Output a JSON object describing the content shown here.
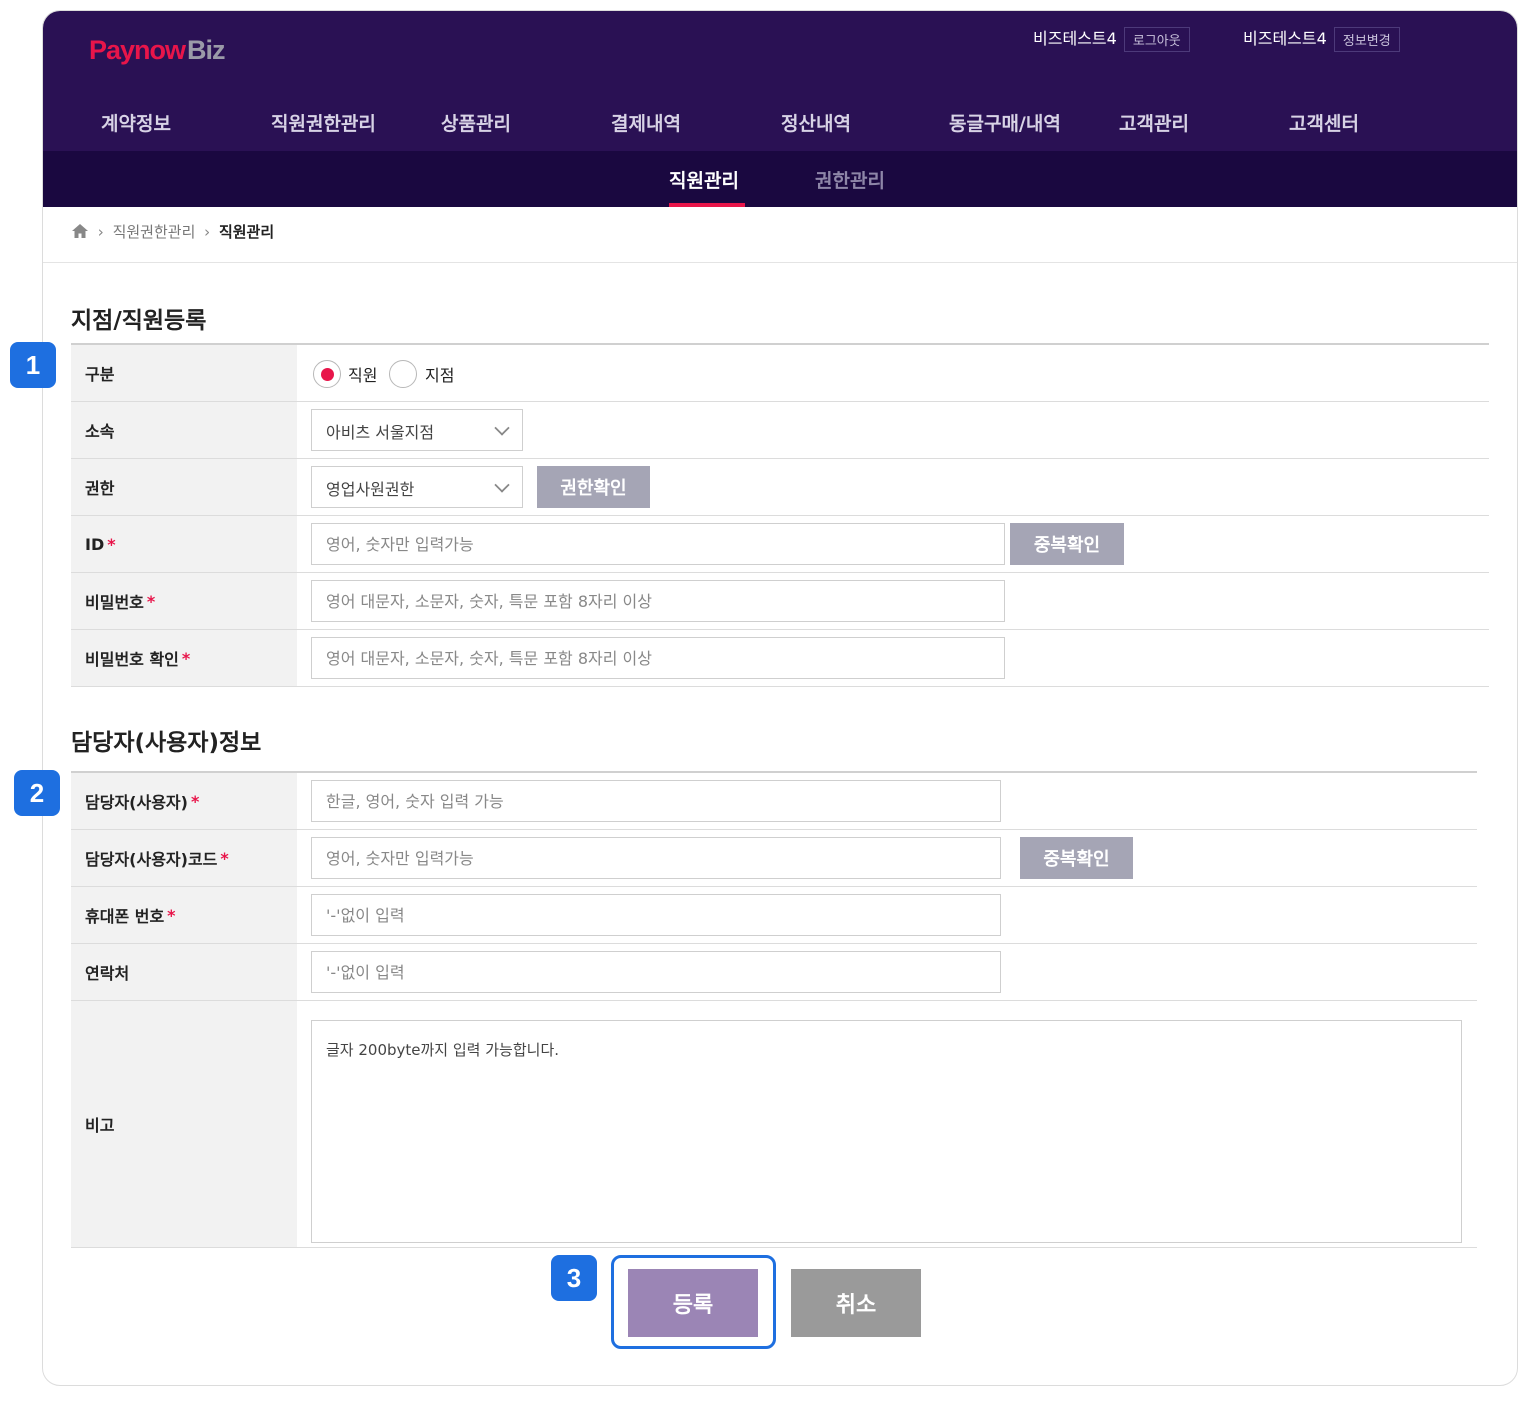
{
  "header": {
    "logo_part1": "Paynow",
    "logo_part2": "Biz",
    "user1_name": "비즈테스트4",
    "user1_btn": "로그아웃",
    "user2_name": "비즈테스트4",
    "user2_btn": "정보변경"
  },
  "nav": {
    "items": [
      "계약정보",
      "직원권한관리",
      "상품관리",
      "결제내역",
      "정산내역",
      "동글구매/내역",
      "고객관리",
      "고객센터"
    ],
    "sub_items": [
      "직원관리",
      "권한관리"
    ]
  },
  "breadcrumb": {
    "parent": "직원권한관리",
    "current": "직원관리"
  },
  "section1": {
    "title": "지점/직원등록",
    "type_label": "구분",
    "radio_staff": "직원",
    "radio_branch": "지점",
    "affiliation_label": "소속",
    "affiliation_value": "아비츠 서울지점",
    "permission_label": "권한",
    "permission_value": "영업사원권한",
    "permission_check_btn": "권한확인",
    "id_label": "ID",
    "id_placeholder": "영어, 숫자만 입력가능",
    "id_dup_btn": "중복확인",
    "pw_label": "비밀번호",
    "pw_placeholder": "영어 대문자, 소문자, 숫자, 특문 포함 8자리 이상",
    "pw_confirm_label": "비밀번호 확인",
    "pw_confirm_placeholder": "영어 대문자, 소문자, 숫자, 특문 포함 8자리 이상"
  },
  "section2": {
    "title": "담당자(사용자)정보",
    "manager_label": "담당자(사용자)",
    "manager_placeholder": "한글, 영어, 숫자 입력 가능",
    "code_label": "담당자(사용자)코드",
    "code_placeholder": "영어, 숫자만 입력가능",
    "code_dup_btn": "중복확인",
    "mobile_label": "휴대폰 번호",
    "mobile_placeholder": "'-'없이 입력",
    "contact_label": "연락처",
    "contact_placeholder": "'-'없이 입력",
    "memo_label": "비고",
    "memo_text": "글자 200byte까지 입력 가능합니다."
  },
  "actions": {
    "submit": "등록",
    "cancel": "취소"
  },
  "badges": [
    "1",
    "2",
    "3"
  ],
  "required_mark": "*",
  "colors": {
    "header_bg": "#2a1154",
    "subnav_bg": "#1a0840",
    "accent": "#e8154a",
    "badge": "#1e6fe0",
    "submit_btn": "#9b85b5"
  }
}
